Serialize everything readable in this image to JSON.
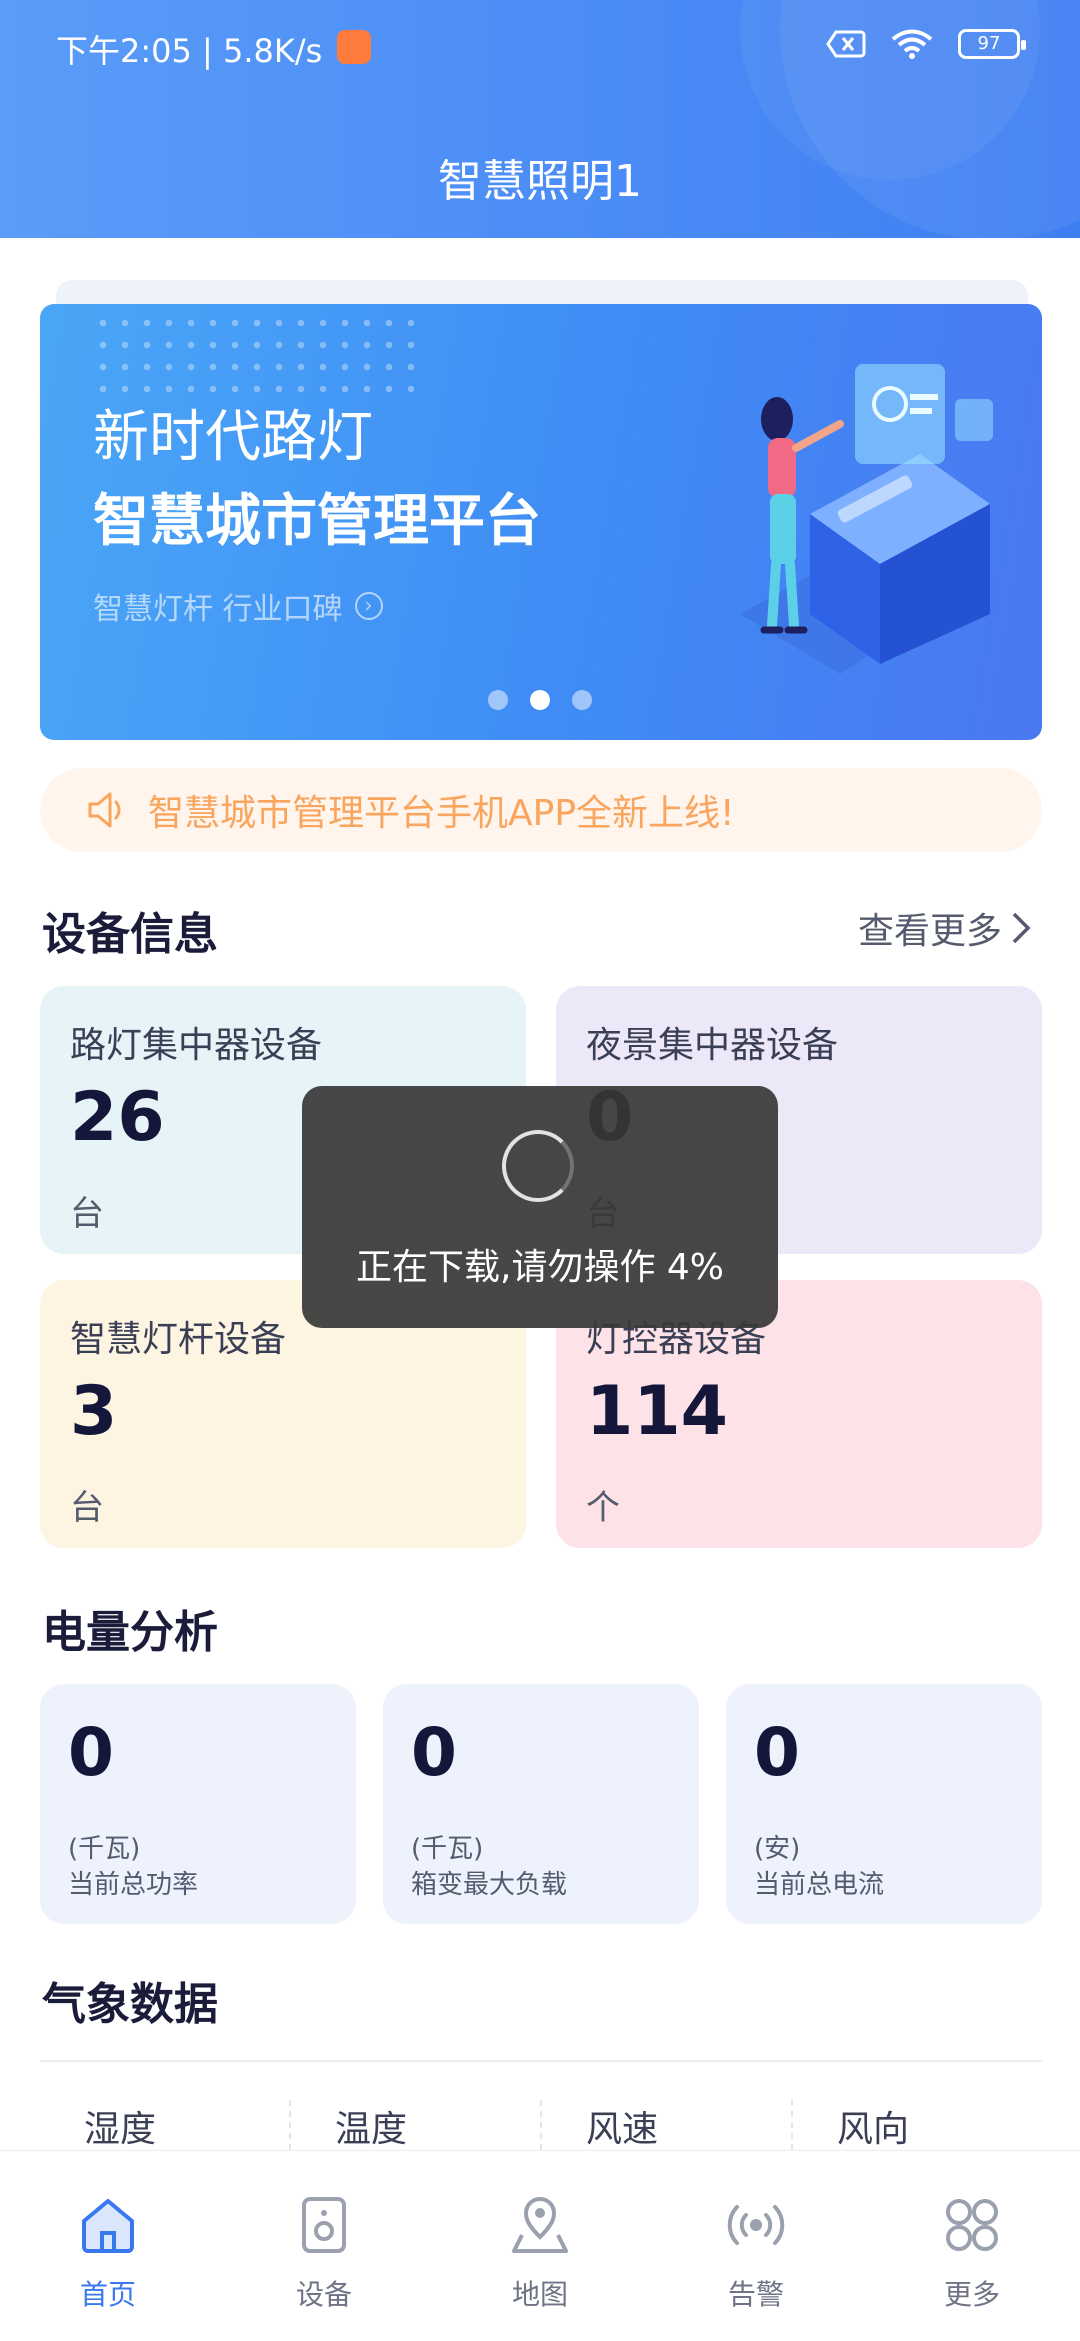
{
  "status_bar": {
    "time_speed": "下午2:05 | 5.8K/s",
    "battery": "97"
  },
  "header": {
    "title": "智慧照明1"
  },
  "banner": {
    "line1": "新时代路灯",
    "line2": "智慧城市管理平台",
    "subtitle": "智慧灯杆 行业口碑",
    "page_count": 3,
    "active_page": 2
  },
  "notice": {
    "text": "智慧城市管理平台手机APP全新上线!"
  },
  "device_info": {
    "title": "设备信息",
    "more_label": "查看更多",
    "cards": [
      {
        "label": "路灯集中器设备",
        "value": "26",
        "unit": "台",
        "color": "#e6f3f7"
      },
      {
        "label": "夜景集中器设备",
        "value": "0",
        "unit": "台",
        "color": "#ece8f8"
      },
      {
        "label": "智慧灯杆设备",
        "value": "3",
        "unit": "台",
        "color": "#fdf4e2"
      },
      {
        "label": "灯控器设备",
        "value": "114",
        "unit": "个",
        "color": "#fde3e7"
      }
    ]
  },
  "power_analysis": {
    "title": "电量分析",
    "cards": [
      {
        "value": "0",
        "unit": "(千瓦)",
        "label": "当前总功率"
      },
      {
        "value": "0",
        "unit": "(千瓦)",
        "label": "箱变最大负载"
      },
      {
        "value": "0",
        "unit": "(安)",
        "label": "当前总电流"
      }
    ]
  },
  "weather": {
    "title": "气象数据",
    "columns": [
      "湿度",
      "温度",
      "风速",
      "风向"
    ]
  },
  "toast": {
    "text": "正在下载,请勿操作 4%",
    "progress_percent": 4
  },
  "tabbar": {
    "active_color": "#3a78f2",
    "items": [
      {
        "label": "首页",
        "icon": "home-icon"
      },
      {
        "label": "设备",
        "icon": "device-icon"
      },
      {
        "label": "地图",
        "icon": "map-pin-icon"
      },
      {
        "label": "告警",
        "icon": "alarm-signal-icon"
      },
      {
        "label": "更多",
        "icon": "more-grid-icon"
      }
    ]
  }
}
